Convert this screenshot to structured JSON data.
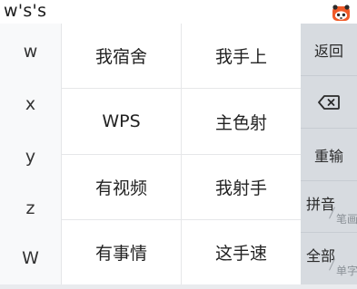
{
  "composing": {
    "text": "w's's"
  },
  "logo": {
    "icon": "ime-panda-logo-icon",
    "color_primary": "#f05a28",
    "color_secondary": "#2b2b2b"
  },
  "letters": [
    "w",
    "x",
    "y",
    "z",
    "W"
  ],
  "candidates": [
    [
      "我宿舍",
      "我手上"
    ],
    [
      "WPS",
      "主色射"
    ],
    [
      "有视频",
      "我射手"
    ],
    [
      "有事情",
      "这手速"
    ]
  ],
  "functions": {
    "back": "返回",
    "delete_icon": "backspace-icon",
    "retype": "重输",
    "pinyin": {
      "main": "拼音",
      "sub": "笔画"
    },
    "all": {
      "main": "全部",
      "sub": "单字"
    }
  },
  "colors": {
    "function_bg": "#d7dbe0",
    "letter_bg": "#f8f9fa",
    "divider": "#e6e7e9"
  }
}
